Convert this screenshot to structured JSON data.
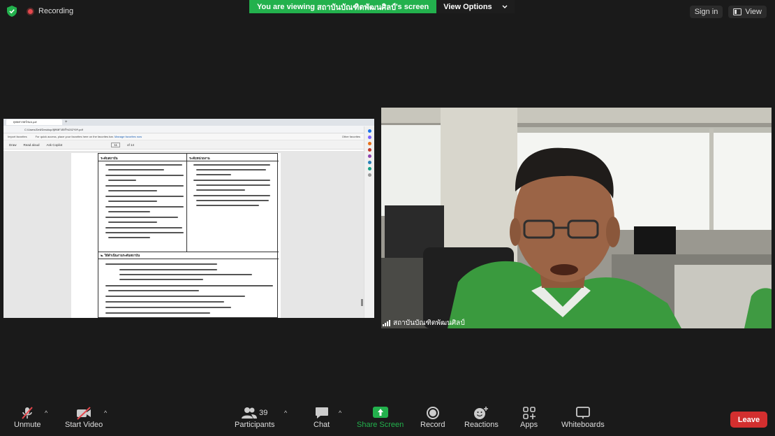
{
  "top": {
    "recording_label": "Recording",
    "banner_text_prefix": "You are viewing ",
    "banner_text_name": "สถาบันบัณฑิตพัฒนศิลป์",
    "banner_text_suffix": "'s screen",
    "view_options_label": "View Options",
    "sign_in_label": "Sign in",
    "view_label": "View"
  },
  "shared_screen": {
    "tab_title": "ยุทธศาสตร์สมอ.pdf",
    "url": "C:/Users/Dell/Desktop/ยุทธศาสตร์%202ฯลฯ.pdf",
    "favbar_import": "Import favorites",
    "favbar_hint": "For quick access, place your favorites here on the favorites bar.",
    "favbar_link": "Manage favorites now",
    "favbar_other": "Other favorites",
    "pdf_tools": [
      "Draw",
      "Read aloud",
      "Ask Copilot"
    ],
    "page_number": "11",
    "page_total": "of 14",
    "col_left_head": "ระดับสถาบัน",
    "col_right_head": "ระดับหน่วยงาน",
    "section_title": "๒. วิธีดำเนินงานระดับสถาบัน"
  },
  "participant": {
    "name": "สถาบันบัณฑิตพัฒนศิลป์"
  },
  "toolbar": {
    "unmute": "Unmute",
    "start_video": "Start Video",
    "participants": "Participants",
    "participants_count": "39",
    "chat": "Chat",
    "share_screen": "Share Screen",
    "record": "Record",
    "reactions": "Reactions",
    "apps": "Apps",
    "whiteboards": "Whiteboards",
    "leave": "Leave"
  },
  "colors": {
    "banner_green": "#23b14d",
    "share_green": "#23b14d",
    "leave_red": "#d32f2f",
    "background": "#1a1a1a"
  }
}
